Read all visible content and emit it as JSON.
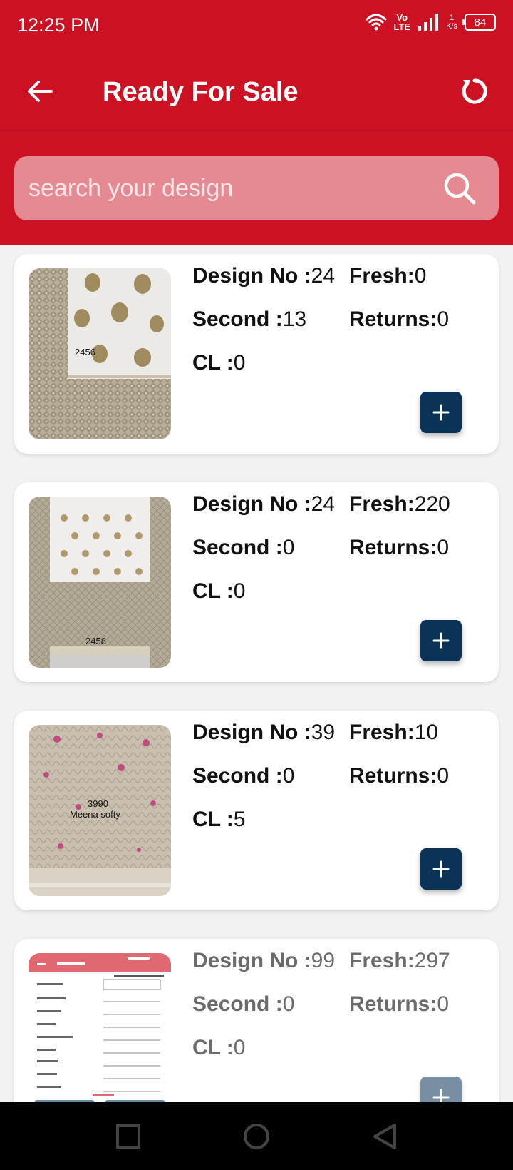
{
  "status_bar": {
    "time": "12:25 PM",
    "network_label_top": "Vo",
    "network_label_bottom": "LTE",
    "speed_value": "1",
    "speed_unit": "K/s",
    "battery": "84"
  },
  "header": {
    "title": "Ready For Sale",
    "back_icon": "arrow-left-icon",
    "refresh_icon": "refresh-icon"
  },
  "search": {
    "placeholder": "search your design",
    "icon": "search-icon"
  },
  "labels": {
    "design_no": "Design No :",
    "fresh": "Fresh:",
    "second": "Second :",
    "returns": "Returns:",
    "cl": "CL :"
  },
  "items": [
    {
      "image_caption": "2456",
      "design_no": "24",
      "fresh": "0",
      "second": "13",
      "returns": "0",
      "cl": "0"
    },
    {
      "image_caption": "2458",
      "design_no": "24",
      "fresh": "220",
      "second": "0",
      "returns": "0",
      "cl": "0"
    },
    {
      "image_caption": "3990",
      "image_caption_2": "Meena softy",
      "design_no": "39",
      "fresh": "10",
      "second": "0",
      "returns": "0",
      "cl": "5"
    },
    {
      "image_caption": "",
      "design_no": "99",
      "fresh": "297",
      "second": "0",
      "returns": "0",
      "cl": "0"
    }
  ],
  "colors": {
    "primary": "#cc1122",
    "search_bg": "#e58a93",
    "add_button": "#0b3358",
    "list_bg": "#f2f2f2"
  }
}
